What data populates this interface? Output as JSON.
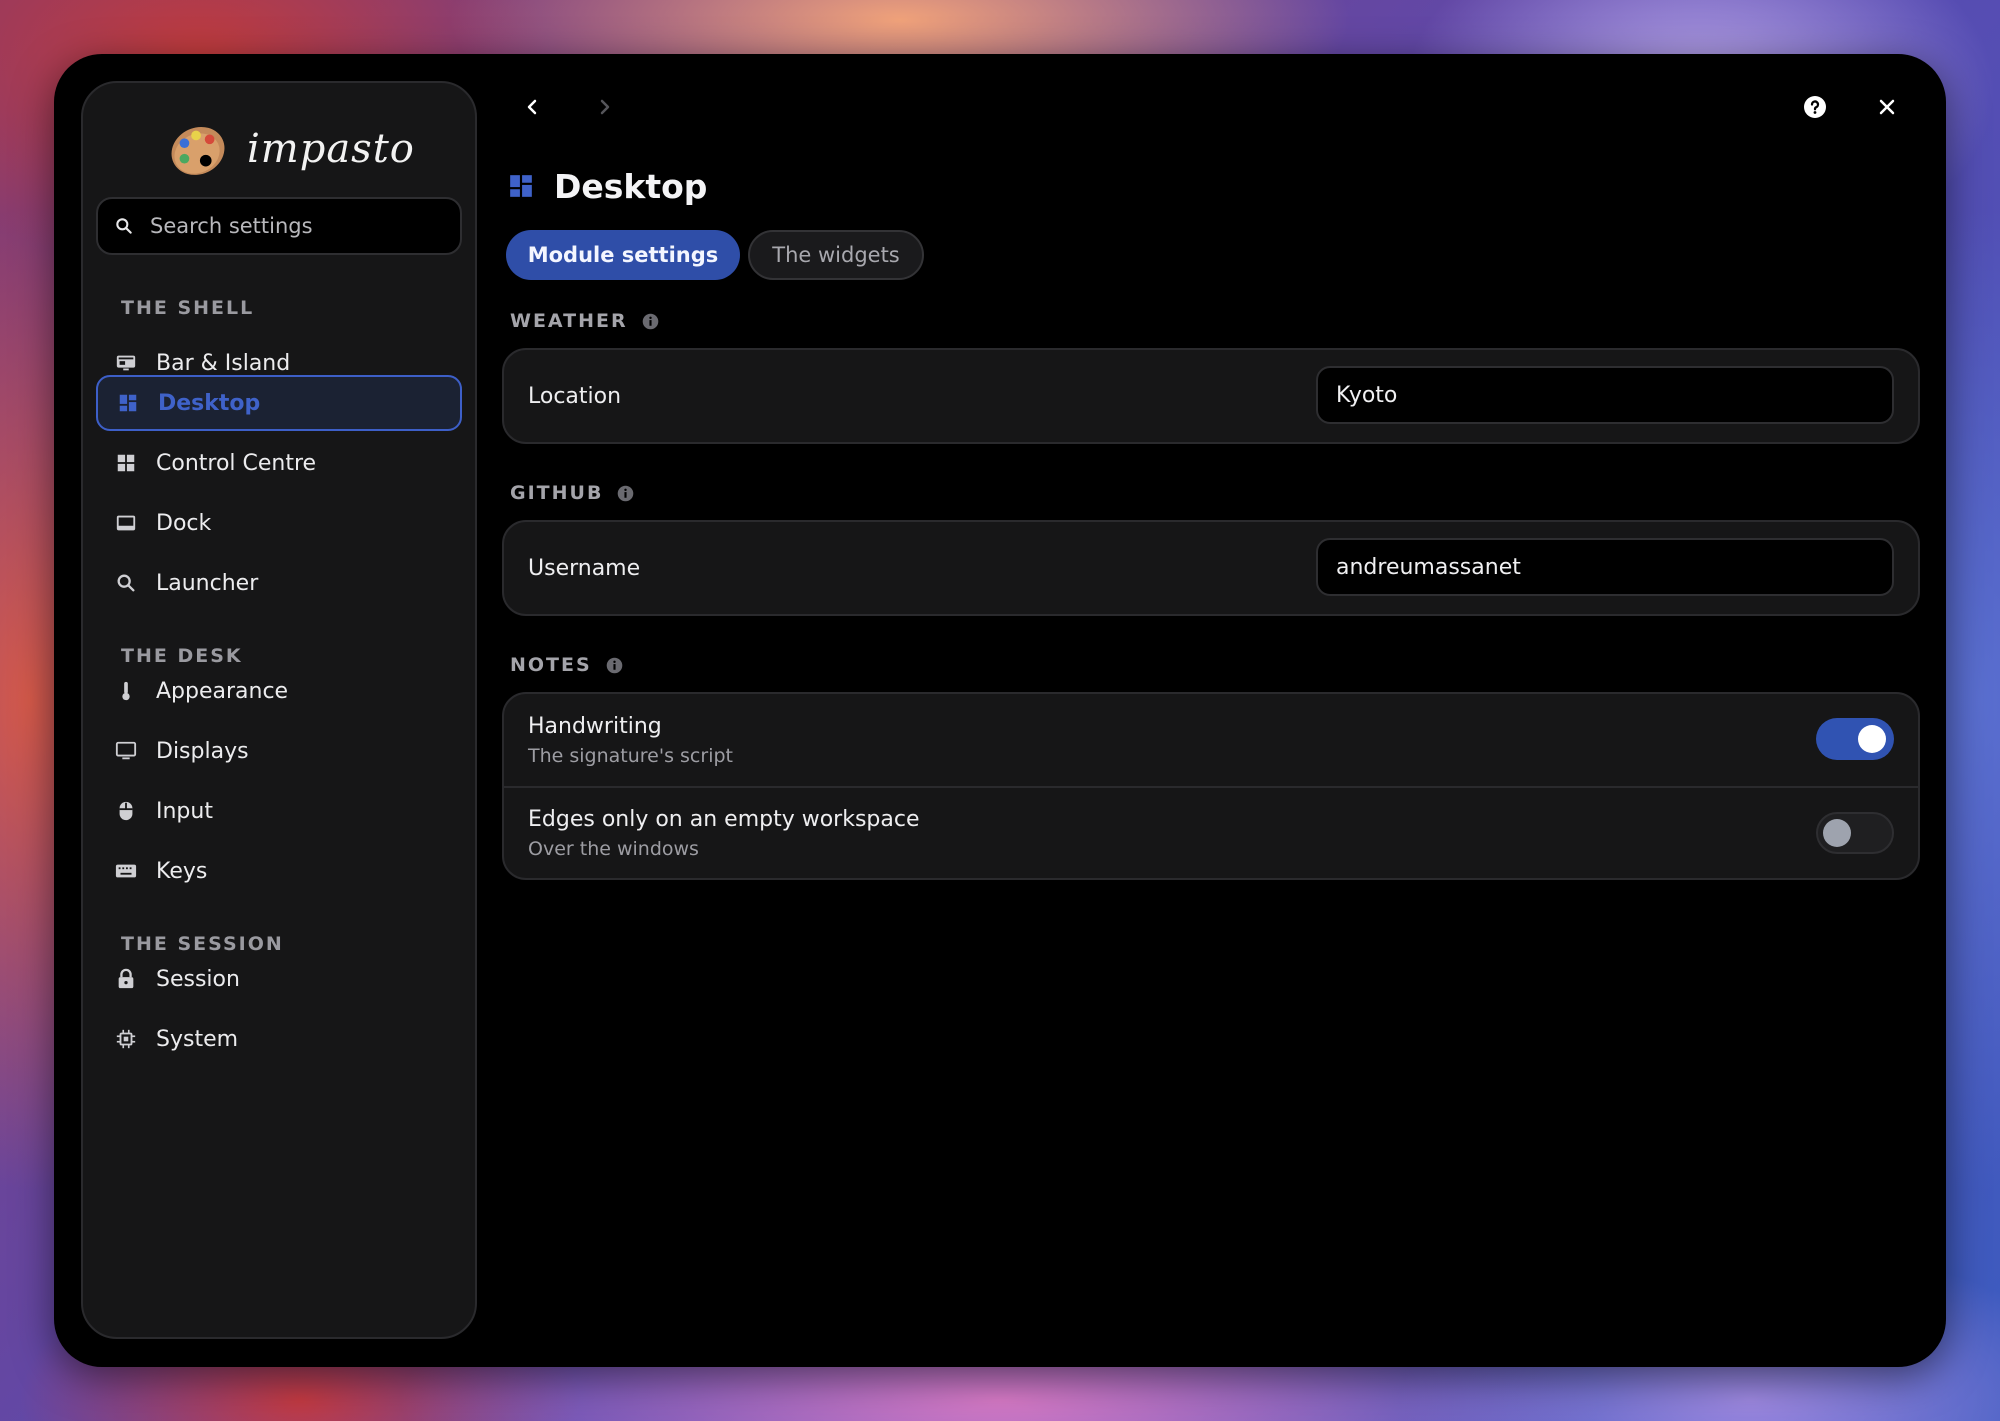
{
  "app": {
    "name": "impasto"
  },
  "search": {
    "placeholder": "Search settings"
  },
  "sidebar": {
    "sections": [
      {
        "title": "THE SHELL",
        "items": [
          {
            "label": "Bar & Island",
            "icon": "monitor-bar-icon"
          },
          {
            "label": "Desktop",
            "icon": "dashboard-icon",
            "active": true
          },
          {
            "label": "Control Centre",
            "icon": "grid-icon"
          },
          {
            "label": "Dock",
            "icon": "dock-icon"
          },
          {
            "label": "Launcher",
            "icon": "search-icon"
          }
        ]
      },
      {
        "title": "THE DESK",
        "items": [
          {
            "label": "Appearance",
            "icon": "thermometer-icon"
          },
          {
            "label": "Displays",
            "icon": "display-icon"
          },
          {
            "label": "Input",
            "icon": "mouse-icon"
          },
          {
            "label": "Keys",
            "icon": "keyboard-icon"
          }
        ]
      },
      {
        "title": "THE SESSION",
        "items": [
          {
            "label": "Session",
            "icon": "lock-icon"
          },
          {
            "label": "System",
            "icon": "chip-icon"
          }
        ]
      }
    ]
  },
  "page": {
    "title": "Desktop",
    "icon": "dashboard-icon"
  },
  "tabs": [
    {
      "label": "Module settings",
      "active": true
    },
    {
      "label": "The widgets",
      "active": false
    }
  ],
  "groups": {
    "weather": {
      "title": "WEATHER",
      "location_label": "Location",
      "location_value": "Kyoto"
    },
    "github": {
      "title": "GITHUB",
      "username_label": "Username",
      "username_value": "andreumassanet"
    },
    "notes": {
      "title": "NOTES",
      "handwriting_label": "Handwriting",
      "handwriting_sub": "The signature's script",
      "handwriting_on": true,
      "edges_label": "Edges only on an empty workspace",
      "edges_sub": "Over the windows",
      "edges_on": false
    }
  },
  "colors": {
    "accent": "#3053b2",
    "accent_text": "#3f62c9",
    "window_bg": "#000000",
    "panel_bg": "#161617"
  }
}
